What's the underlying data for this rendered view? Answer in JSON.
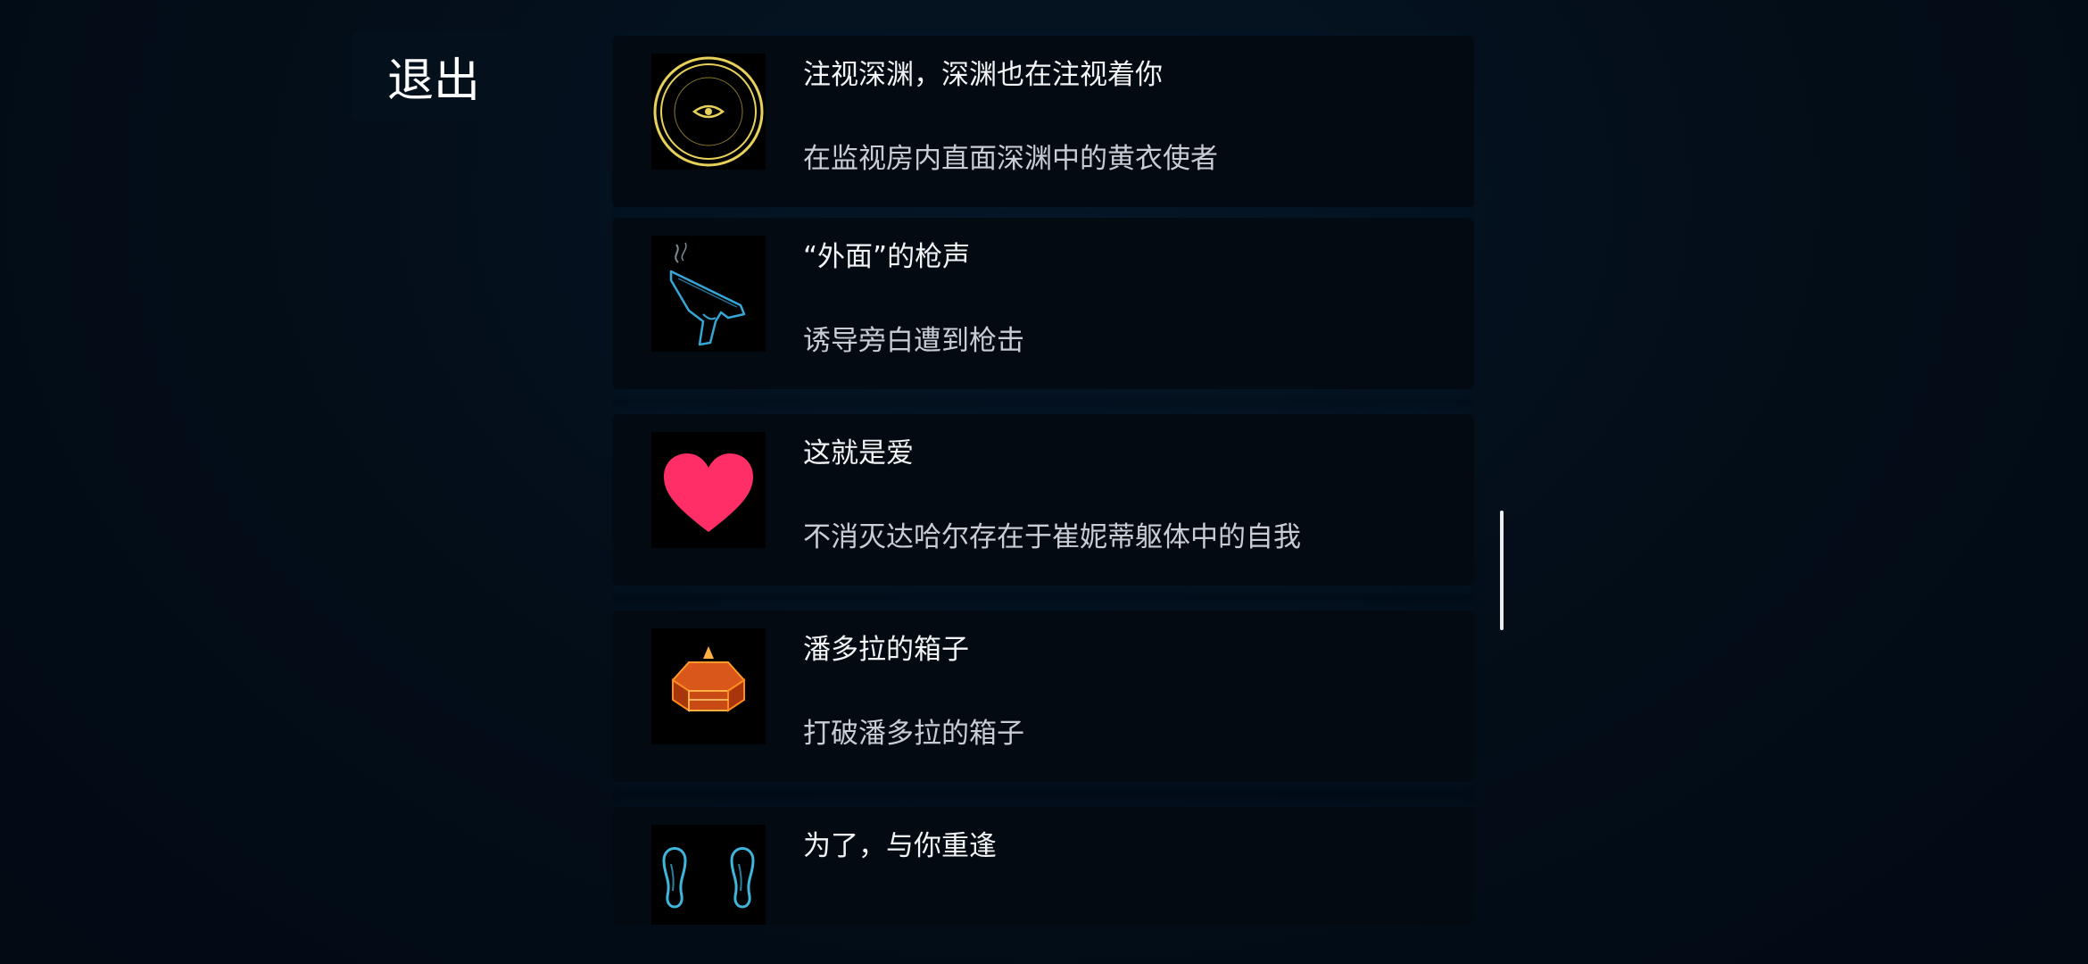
{
  "header": {
    "exit_label": "退出"
  },
  "achievements": [
    {
      "icon": "eye-circle-icon",
      "title": "注视深渊，深渊也在注视着你",
      "description": "在监视房内直面深渊中的黄衣使者",
      "accent": "#e7d15a"
    },
    {
      "icon": "pistol-icon",
      "title": "“外面”的枪声",
      "description": "诱导旁白遭到枪击",
      "accent": "#36a6d6"
    },
    {
      "icon": "heart-icon",
      "title": "这就是爱",
      "description": "不消灭达哈尔存在于崔妮蒂躯体中的自我",
      "accent": "#ff2e66"
    },
    {
      "icon": "pandora-box-icon",
      "title": "潘多拉的箱子",
      "description": "打破潘多拉的箱子",
      "accent": "#ff8a1e"
    },
    {
      "icon": "twin-figures-icon",
      "title": "为了，与你重逢",
      "description": "",
      "accent": "#3fb6dc"
    }
  ]
}
